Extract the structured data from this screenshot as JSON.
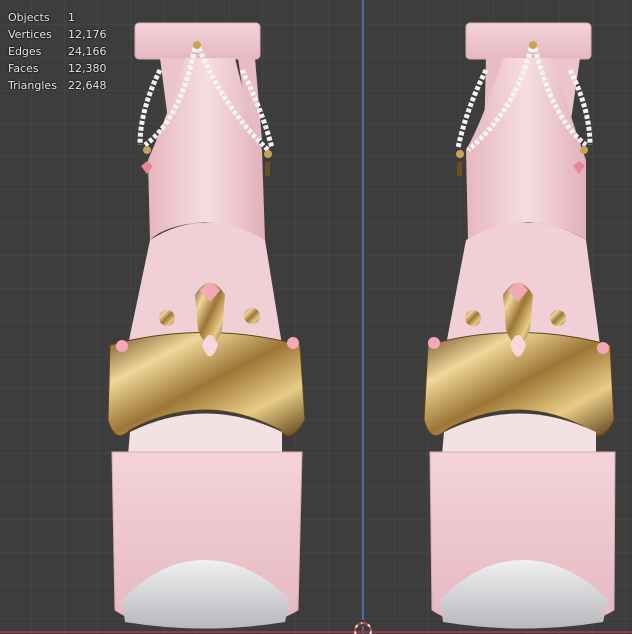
{
  "overlay": {
    "stats": [
      {
        "label": "Objects",
        "value": "1"
      },
      {
        "label": "Vertices",
        "value": "12,176"
      },
      {
        "label": "Edges",
        "value": "24,166"
      },
      {
        "label": "Faces",
        "value": "12,380"
      },
      {
        "label": "Triangles",
        "value": "22,648"
      }
    ]
  },
  "colors": {
    "background": "#3d3d3d",
    "grid": "#4a4a4a",
    "y_axis": "#5a79b8",
    "x_axis": "#8f3a44",
    "shoe_pink": "#f2cdd3",
    "gold": "#c9a35a",
    "pearl": "#f4f4f4"
  }
}
